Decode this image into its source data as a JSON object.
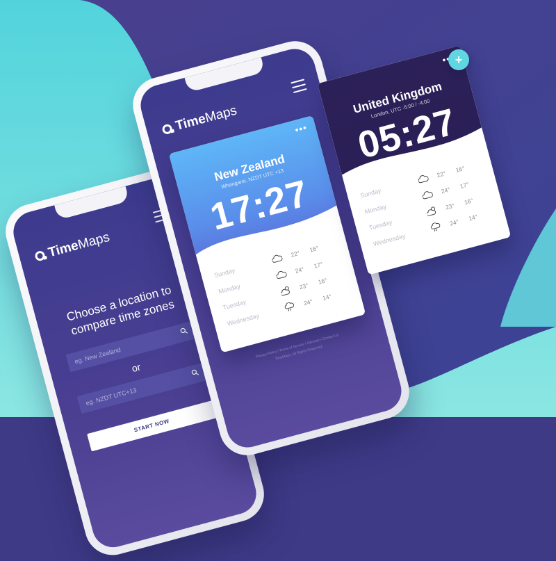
{
  "app": {
    "brand_bold": "Time",
    "brand_light": "Maps",
    "colors": {
      "accent": "#5fd6e0",
      "primary": "#3d3b8e",
      "nz_sky": "#5eb0f5",
      "uk_night": "#2b1f57"
    },
    "icons": [
      "logo-icon",
      "hamburger-menu-icon",
      "search-icon",
      "cloud-icon",
      "sun-cloud-icon",
      "rain-cloud-icon",
      "more-dots-icon",
      "plus-icon"
    ]
  },
  "search_screen": {
    "title_line1": "Choose a location to",
    "title_line2": "compare time zones",
    "location_placeholder": "eg. New Zealand",
    "or_label": "or",
    "timezone_placeholder": "eg. NZDT UTC+13",
    "start_label": "START NOW"
  },
  "nz_card": {
    "more_label": "•••",
    "country": "New Zealand",
    "location": "Whangarei, NZDT UTC +13",
    "time": "17:27",
    "forecast": [
      {
        "day": "Sunday",
        "icon": "cloud-icon",
        "high": "22°",
        "low": "16°"
      },
      {
        "day": "Monday",
        "icon": "cloud-icon",
        "high": "24°",
        "low": "17°"
      },
      {
        "day": "Tuesday",
        "icon": "sun-cloud-icon",
        "high": "23°",
        "low": "16°"
      },
      {
        "day": "Wednesday",
        "icon": "rain-cloud-icon",
        "high": "24°",
        "low": "14°"
      }
    ]
  },
  "uk_card": {
    "more_label": "•••",
    "country": "United Kingdom",
    "location": "London, UTC -5:00 / -4:00",
    "time": "05:27",
    "forecast": [
      {
        "day": "Sunday",
        "icon": "cloud-icon",
        "high": "22°",
        "low": "16°"
      },
      {
        "day": "Monday",
        "icon": "cloud-icon",
        "high": "24°",
        "low": "17°"
      },
      {
        "day": "Tuesday",
        "icon": "sun-cloud-icon",
        "high": "23°",
        "low": "16°"
      },
      {
        "day": "Wednesday",
        "icon": "rain-cloud-icon",
        "high": "24°",
        "low": "14°"
      }
    ]
  },
  "footer": {
    "line1": "Privacy Policy  |  Terms of Service  |  Sitemap  |  Contact Us",
    "line2": "TimeMaps. All Rights Reserved."
  },
  "fab": {
    "label": "+"
  }
}
